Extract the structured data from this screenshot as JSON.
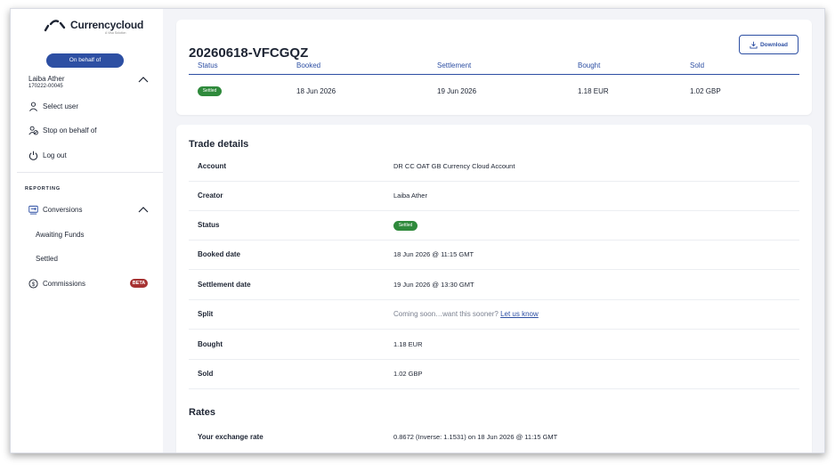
{
  "sidebar": {
    "brand": "Currencycloud",
    "brand_sub": "A Visa Solution",
    "behalf_button": "On behalf of",
    "user": {
      "name": "Laiba Ather",
      "id": "170222-00045"
    },
    "menu": {
      "select_user": "Select user",
      "stop_behalf": "Stop on behalf of",
      "log_out": "Log out"
    },
    "section_reporting": "REPORTING",
    "conversions": "Conversions",
    "awaiting_funds": "Awaiting Funds",
    "settled": "Settled",
    "commissions": "Commissions",
    "beta_badge": "BETA"
  },
  "summary": {
    "trade_id": "20260618-VFCGQZ",
    "download_label": "Download",
    "columns": [
      "Status",
      "Booked",
      "Settlement",
      "Bought",
      "Sold"
    ],
    "row": {
      "status": "Settled",
      "booked": "18 Jun 2026",
      "settlement": "19 Jun 2026",
      "bought": "1.18 EUR",
      "sold": "1.02 GBP"
    }
  },
  "details": {
    "title": "Trade details",
    "account": {
      "label": "Account",
      "value": "DR CC OAT GB Currency Cloud Account"
    },
    "creator": {
      "label": "Creator",
      "value": "Laiba Ather"
    },
    "status": {
      "label": "Status",
      "value": "Settled"
    },
    "booked_date": {
      "label": "Booked date",
      "value": "18 Jun 2026 @ 11:15 GMT"
    },
    "settlement_date": {
      "label": "Settlement date",
      "value": "19 Jun 2026 @ 13:30 GMT"
    },
    "split": {
      "label": "Split",
      "value": "Coming soon…want this sooner?",
      "link": "Let us know"
    },
    "bought": {
      "label": "Bought",
      "value": "1.18 EUR"
    },
    "sold": {
      "label": "Sold",
      "value": "1.02 GBP"
    }
  },
  "rates": {
    "title": "Rates",
    "exchange_rate": {
      "label": "Your exchange rate",
      "value": "0.8672 (Inverse: 1.1531) on 18 Jun 2026 @ 11:15 GMT"
    }
  },
  "colors": {
    "primary": "#2d4fa3",
    "success": "#2f8a3c",
    "beta": "#a63232",
    "background": "#f3f4f8"
  }
}
